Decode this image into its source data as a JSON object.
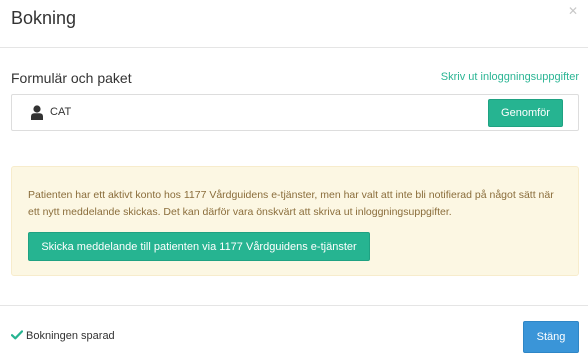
{
  "modal": {
    "title": "Bokning",
    "close_icon": "close-icon"
  },
  "section": {
    "title": "Formulär och paket",
    "print_link": "Skriv ut inloggningsuppgifter"
  },
  "package": {
    "icon": "user-icon",
    "name": "CAT",
    "action_label": "Genomför"
  },
  "notice": {
    "text": "Patienten har ett aktivt konto hos 1177 Vårdguidens e-tjänster, men har valt att inte bli notifierad på något sätt när ett nytt meddelande skickas. Det kan därför vara önskvärt att skriva ut inloggningsuppgifter.",
    "button_label": "Skicka meddelande till patienten via 1177 Vårdguidens e-tjänster"
  },
  "footer": {
    "status_icon": "check-icon",
    "status_text": "Bokningen sparad",
    "close_label": "Stäng"
  },
  "colors": {
    "accent_green": "#26b491",
    "link_green": "#2bb594",
    "primary_blue": "#3a95d8",
    "warning_bg": "#fcf7e3",
    "warning_text": "#8a6d3b"
  }
}
